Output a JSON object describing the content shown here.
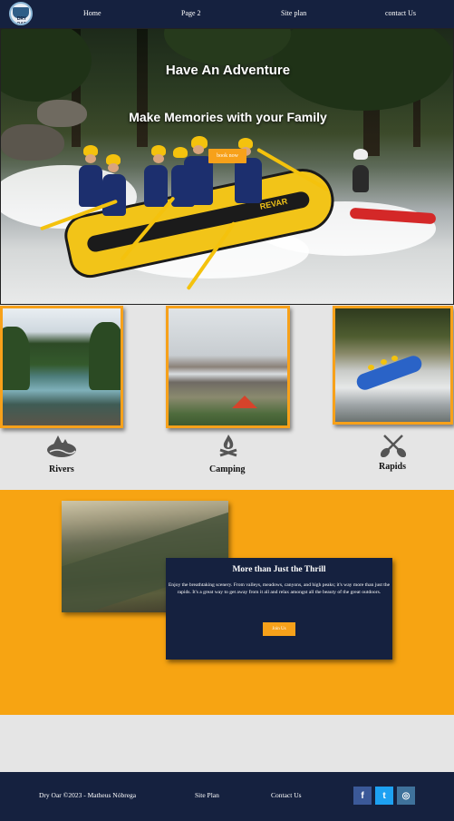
{
  "nav": {
    "logo_text": "DRY OAR",
    "items": [
      {
        "label": "Home"
      },
      {
        "label": "Page 2"
      },
      {
        "label": "Site plan"
      },
      {
        "label": "contact Us"
      }
    ]
  },
  "hero": {
    "title": "Have An Adventure",
    "subtitle": "Make Memories with your Family",
    "button": "book now",
    "raft_brand": "REVAR"
  },
  "features": [
    {
      "label": "Rivers",
      "icon": "river-trees-icon"
    },
    {
      "label": "Camping",
      "icon": "campfire-icon"
    },
    {
      "label": "Rapids",
      "icon": "crossed-paddles-icon"
    }
  ],
  "promo": {
    "title": "More than Just the Thrill",
    "text": "Enjoy the breathtaking scenery. From valleys, meadows, canyons, and high peaks; it's way more than just the rapids. It's a great way to get away from it all and relax amongst all the beauty of the great outdoors.",
    "button": "Join Us"
  },
  "footer": {
    "copyright": "Dry Oar ©2023 - Matheus Nóbrega",
    "links": [
      {
        "label": "Site Plan"
      },
      {
        "label": "Contact Us"
      }
    ],
    "social": [
      {
        "glyph": "f",
        "icon": "facebook-icon",
        "color": "#3b5998"
      },
      {
        "glyph": "t",
        "icon": "twitter-icon",
        "color": "#1da1f2"
      },
      {
        "glyph": "◎",
        "icon": "instagram-icon",
        "color": "#3f729b"
      }
    ]
  },
  "colors": {
    "navy": "#15213f",
    "accent": "#f7a11a",
    "page_bg": "#e5e5e5"
  }
}
